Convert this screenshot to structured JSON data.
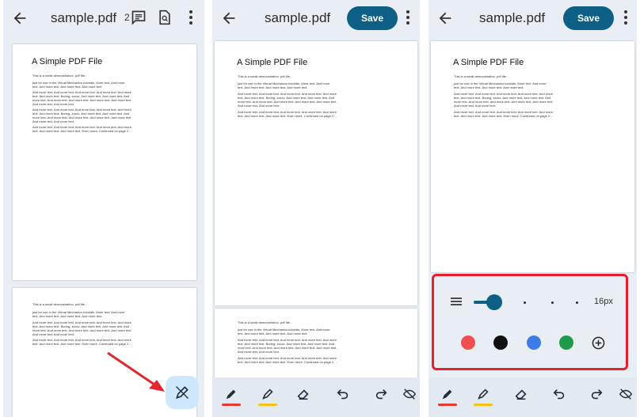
{
  "panels": [
    {
      "title": "sample.pdf",
      "comment_count": "2"
    },
    {
      "title": "sample.pdf",
      "save_label": "Save"
    },
    {
      "title": "sample.pdf",
      "save_label": "Save"
    }
  ],
  "doc": {
    "title": "A Simple PDF File",
    "intro": "This is a small demonstration .pdf file -",
    "p1": [
      "just for use in the Virtual Mechanics tutorials. More text. And more",
      "text. And more text. And more text. And more text."
    ],
    "p2": [
      "And more text. And more text. And more text. And more text. And more",
      "text. And more text. Boring, zzzzz. And more text. And more text. And",
      "more text. And more text. And more text. And more text. And more text.",
      "And more text. And more text."
    ],
    "p3": [
      "And more text. And more text. And more text. And more text. And more",
      "text. And more text. And more text. Even more. Continued on page 2 ..."
    ]
  },
  "tools": [
    "pen-tool",
    "highlighter-tool",
    "eraser-tool",
    "undo",
    "redo",
    "hide-annotations"
  ],
  "stroke_size": "16px",
  "stroke_level": 0.2,
  "colors": {
    "accent": "#0e5f86",
    "pen_indicator": "#e53935",
    "highlighter_indicator": "#f2c21b",
    "swatch_red": "#ef4f4f",
    "swatch_black": "#111111",
    "swatch_blue": "#3d7be6",
    "swatch_green": "#1e9a4a",
    "annotation_arrow": "#e0292f"
  }
}
